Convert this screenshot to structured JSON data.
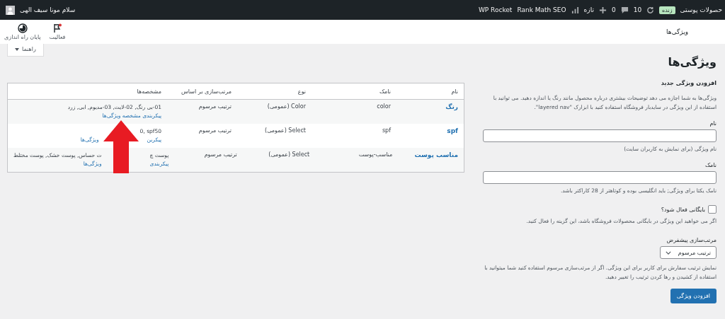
{
  "admin_bar": {
    "site": "حصولات پوستی",
    "live_badge": "زنده",
    "updates": "10",
    "comments": "0",
    "new": "تازه",
    "seo": "Rank Math SEO",
    "rocket": "WP Rocket",
    "greeting": "سلام مونا سیف الهی"
  },
  "header": {
    "title": "ویژگی‌ها",
    "actions": [
      {
        "kind": "flag",
        "label": "فعالیت"
      },
      {
        "kind": "progress",
        "label": "پایان راه اندازی"
      }
    ]
  },
  "help_tab": {
    "label": "راهنما",
    "expanded": false
  },
  "page_title": "ویژگی‌ها",
  "form": {
    "heading": "افزودن ویژگی جدید",
    "intro": "ویژگی‌ها به شما اجازه می دهد توضیحات بیشتری درباره محصول مانند رنگ یا اندازه دهید. می توانید با استفاده از این ویژگی در سایدبار فروشگاه استفاده کنید با ابزارک \"layered nav\".",
    "name_label": "نام",
    "name_hint": "نام ویژگی (برای نمایش به کاربران سایت)",
    "slug_label": "نامک",
    "slug_hint": "نامک یکتا برای ویژگی; باید انگلیسی بوده و کوتاهتر از 28 کاراکتر باشد.",
    "archive_label": "بایگانی فعال شود؟",
    "archive_checked": false,
    "archive_hint": "اگر می خواهید این ویژگی در بایگانی محصولات فروشگاه باشد، این گزینه را فعال کنید.",
    "order_label": "مرتب‌سازی پیشفرض",
    "order_value": "ترتیب مرسوم",
    "order_hint": "نمایش ترتیب سفارش برای کاربر برای این ویژگی. اگر از مرتب‌سازی مرسوم استفاده کنید شما میتوانید با استفاده از کشیدن و رها کردن ترتیب را تغییر دهید.",
    "submit": "افزودن ویژگی"
  },
  "table": {
    "columns": [
      "نام",
      "نامک",
      "نوع",
      "مرتب‌سازی بر اساس",
      "مشخصه‌ها"
    ],
    "rows": [
      {
        "name": "رنگ",
        "slug": "color",
        "type": "Color (عمومی)",
        "order": "ترتیب مرسوم",
        "terms": [
          "01-بی رنگ, 02-لایت, 03-مدیوم, ابی, زرد"
        ],
        "link": [
          "پیکربندی مشخصه ویژگی‌ها"
        ]
      },
      {
        "name": "spf",
        "slug": "spf",
        "type": "Select (عمومی)",
        "order": "ترتیب مرسوم",
        "terms": [
          "0, spf50"
        ],
        "link": [
          "پیکربن",
          "ویژگی‌ها"
        ]
      },
      {
        "name": "مناسب پوست",
        "slug": "مناسب-پوست",
        "type": "Select (عمومی)",
        "order": "ترتیب مرسوم",
        "terms": [
          "پوست چ",
          "ت حساس, پوست خشک, پوست مختلط"
        ],
        "link": [
          "پیکربندی",
          "ویژگی‌ها"
        ]
      }
    ]
  }
}
